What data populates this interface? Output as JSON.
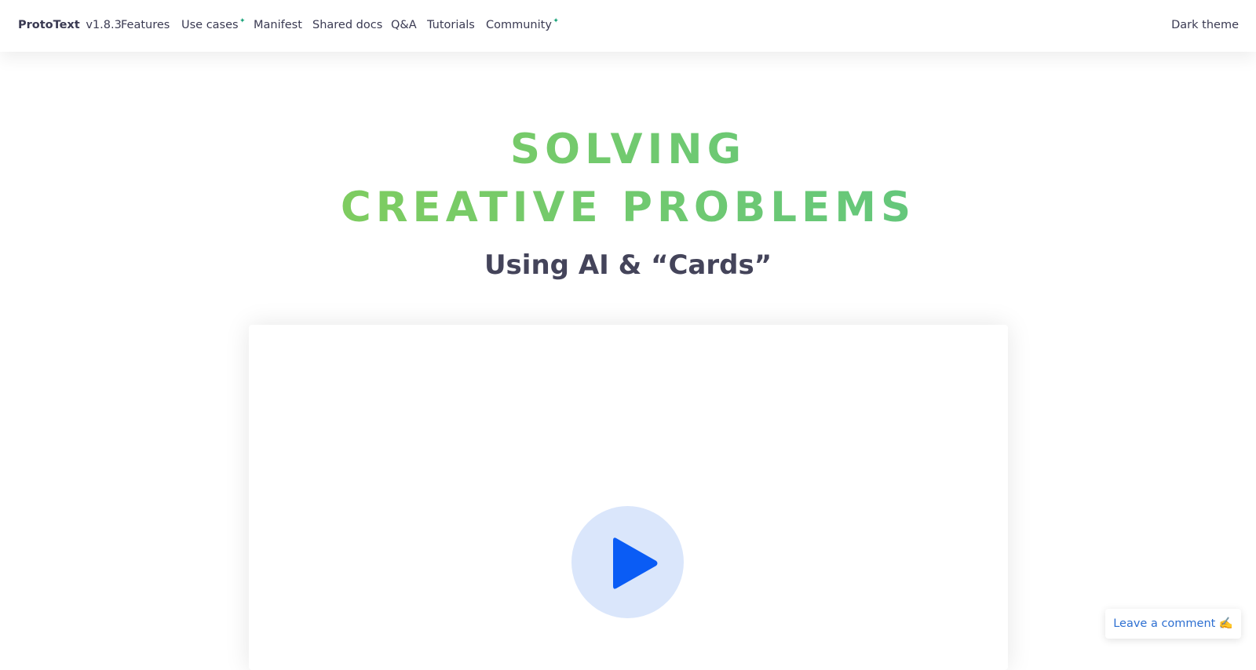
{
  "header": {
    "brand_name": "ProtoText",
    "brand_version": "v1.8.3",
    "nav": [
      {
        "label": "Features",
        "badge": ""
      },
      {
        "label": "Use cases",
        "badge": "✦"
      },
      {
        "label": "Manifest",
        "badge": ""
      },
      {
        "label": "Shared docs",
        "badge": ""
      },
      {
        "label": "Q&A",
        "badge": ""
      },
      {
        "label": "Tutorials",
        "badge": ""
      },
      {
        "label": "Community",
        "badge": "✦"
      }
    ],
    "theme_toggle": "Dark theme"
  },
  "hero": {
    "line1": "SOLVING",
    "line2": "CREATIVE PROBLEMS",
    "subtitle": "Using AI & “Cards”"
  },
  "video": {
    "play_icon": "play-icon"
  },
  "floating": {
    "comment_label": "Leave a comment ✍️"
  },
  "colors": {
    "accent_new": "#1aa37a",
    "play_blue": "#0a5cf5",
    "play_bg": "#dae6fb",
    "gradient_start": "#8dcf4e",
    "gradient_end": "#55c48b",
    "link_blue": "#2d6fd1"
  }
}
